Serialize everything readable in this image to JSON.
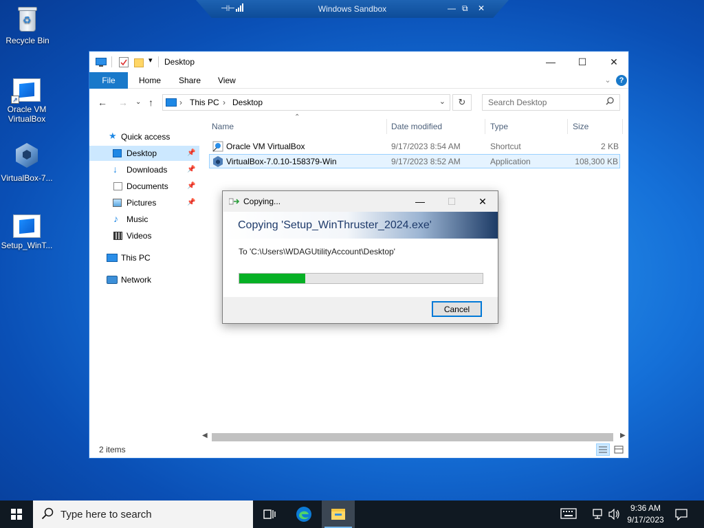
{
  "sandbox": {
    "title": "Windows Sandbox"
  },
  "desktop": {
    "icons": [
      {
        "label": "Recycle Bin"
      },
      {
        "label": "Oracle VM\nVirtualBox",
        "line1": "Oracle VM",
        "line2": "VirtualBox"
      },
      {
        "label": "VirtualBox-7..."
      },
      {
        "label": "Setup_WinT..."
      }
    ]
  },
  "explorer": {
    "title": "Desktop",
    "ribbon": {
      "file": "File",
      "home": "Home",
      "share": "Share",
      "view": "View"
    },
    "address": {
      "crumb1": "This PC",
      "crumb2": "Desktop"
    },
    "search": {
      "placeholder": "Search Desktop"
    },
    "nav": {
      "quick_access": "Quick access",
      "items": [
        {
          "label": "Desktop",
          "pinned": true
        },
        {
          "label": "Downloads",
          "pinned": true
        },
        {
          "label": "Documents",
          "pinned": true
        },
        {
          "label": "Pictures",
          "pinned": true
        },
        {
          "label": "Music",
          "pinned": false
        },
        {
          "label": "Videos",
          "pinned": false
        }
      ],
      "this_pc": "This PC",
      "network": "Network"
    },
    "columns": {
      "name": "Name",
      "date": "Date modified",
      "type": "Type",
      "size": "Size"
    },
    "files": [
      {
        "name": "Oracle VM VirtualBox",
        "date": "9/17/2023 8:54 AM",
        "type": "Shortcut",
        "size": "2 KB"
      },
      {
        "name": "VirtualBox-7.0.10-158379-Win",
        "date": "9/17/2023 8:52 AM",
        "type": "Application",
        "size": "108,300 KB"
      }
    ],
    "status": {
      "count": "2 items"
    }
  },
  "dialog": {
    "title": "Copying...",
    "heading": "Copying 'Setup_WinThruster_2024.exe'",
    "destination": "To 'C:\\Users\\WDAGUtilityAccount\\Desktop'",
    "progress_fraction": 0.27,
    "cancel": "Cancel"
  },
  "taskbar": {
    "search_placeholder": "Type here to search",
    "time": "9:36 AM",
    "date": "9/17/2023"
  }
}
